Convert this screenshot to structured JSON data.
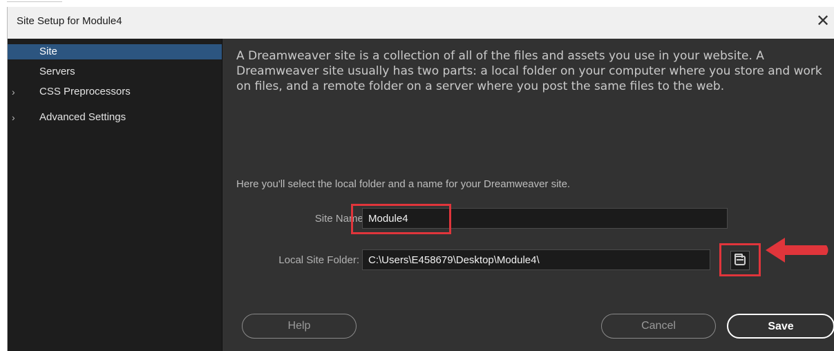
{
  "window": {
    "title": "Site Setup for Module4",
    "close_glyph": "✕"
  },
  "sidebar": {
    "items": [
      {
        "label": "Site",
        "selected": true,
        "expandable": false
      },
      {
        "label": "Servers",
        "selected": false,
        "expandable": false
      },
      {
        "label": "CSS Preprocessors",
        "selected": false,
        "expandable": true
      },
      {
        "label": "Advanced Settings",
        "selected": false,
        "expandable": true
      }
    ],
    "chevron_glyph": "›"
  },
  "content": {
    "description": "A Dreamweaver site is a collection of all of the files and assets you use in your website. A Dreamweaver site usually has two parts: a local folder on your computer where you store and work on files, and a remote folder on a server where you post the same files to the web.",
    "helper_text": "Here you'll select the local folder and a name for your Dreamweaver site.",
    "site_name": {
      "label": "Site Name:",
      "value": "Module4"
    },
    "local_folder": {
      "label": "Local Site Folder:",
      "value": "C:\\Users\\E458679\\Desktop\\Module4\\",
      "browse_icon": "folder-icon"
    }
  },
  "buttons": {
    "help": "Help",
    "cancel": "Cancel",
    "save": "Save"
  },
  "annotations": {
    "highlight_color": "#e0353b",
    "arrow_color": "#e0353b"
  },
  "colors": {
    "sidebar_bg": "#1d1d1d",
    "content_bg": "#323232",
    "selection": "#2c5580"
  }
}
